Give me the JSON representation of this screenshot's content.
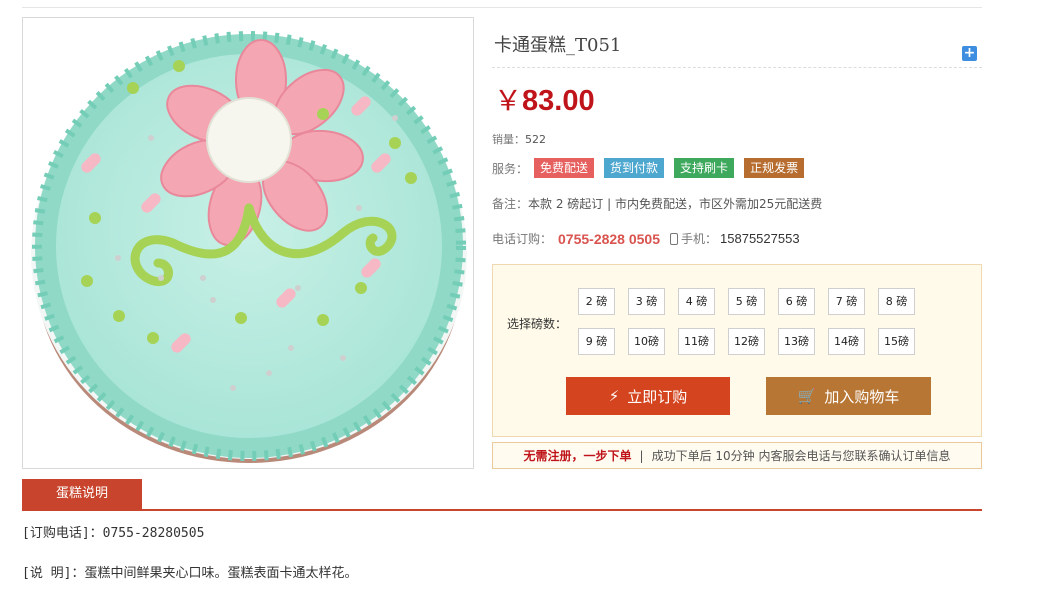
{
  "product": {
    "title": "卡通蛋糕_T051",
    "expand_icon": "plus-square-icon",
    "currency": "￥",
    "price": "83.00",
    "sales_label": "销量：",
    "sales_value": "522",
    "services_label": "服务：",
    "services": [
      {
        "label": "免费配送",
        "color": "#e5605f"
      },
      {
        "label": "货到付款",
        "color": "#4ea7cf"
      },
      {
        "label": "支持刷卡",
        "color": "#3ea85d"
      },
      {
        "label": "正规发票",
        "color": "#b66d2f"
      }
    ],
    "note_label": "备注：",
    "note_text": "本款 2 磅起订 | 市内免费配送，市区外需加25元配送费",
    "phone_label": "电话订购：",
    "phone_value": "0755-2828 0505",
    "mobile_label": "手机：",
    "mobile_value": "15875527553"
  },
  "weight": {
    "label": "选择磅数：",
    "options": [
      "2 磅",
      "3 磅",
      "4 磅",
      "5 磅",
      "6 磅",
      "7 磅",
      "8 磅",
      "9 磅",
      "10磅",
      "11磅",
      "12磅",
      "13磅",
      "14磅",
      "15磅"
    ]
  },
  "actions": {
    "buy_label": "立即订购",
    "buy_icon": "lightning-icon",
    "cart_label": "加入购物车",
    "cart_icon": "cart-icon"
  },
  "notice": {
    "highlight": "无需注册，一步下单",
    "separator": "|",
    "text": "成功下单后 10分钟 内客服会电话与您联系确认订单信息"
  },
  "tabs": {
    "active": "蛋糕说明"
  },
  "description": {
    "line1": "[订购电话]：0755-28280505",
    "line2": "[说 明]：蛋糕中间鲜果夹心口味。蛋糕表面卡通太样花。"
  },
  "colors": {
    "accent": "#c0141b",
    "tab": "#c8442c",
    "buy": "#d4441f",
    "cart": "#b87635"
  }
}
